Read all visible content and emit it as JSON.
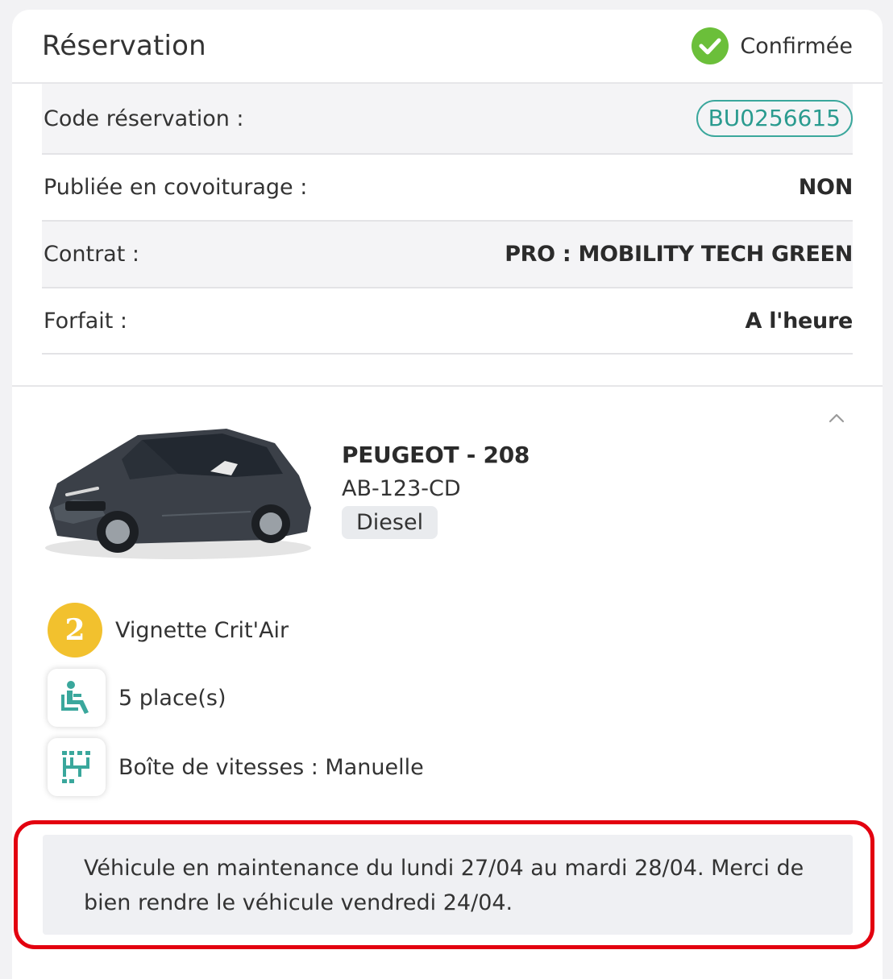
{
  "header": {
    "title": "Réservation",
    "status": {
      "label": "Confirmée",
      "icon": "check-circle-icon",
      "color": "#6bbf3a"
    }
  },
  "details": [
    {
      "label": "Code réservation :",
      "value": "BU0256615"
    },
    {
      "label": "Publiée en covoiturage :",
      "value": "NON"
    },
    {
      "label": "Contrat :",
      "value": "PRO : MOBILITY TECH GREEN"
    },
    {
      "label": "Forfait :",
      "value": "A l'heure"
    }
  ],
  "vehicle": {
    "name": "PEUGEOT - 208",
    "plate": "AB-123-CD",
    "fuel": "Diesel",
    "collapse_icon": "chevron-up-icon"
  },
  "features": [
    {
      "icon": "critair-2-icon",
      "badge": "2",
      "text": "Vignette Crit'Air"
    },
    {
      "icon": "seat-icon",
      "text": "5 place(s)"
    },
    {
      "icon": "gearbox-icon",
      "text": "Boîte de vitesses : Manuelle"
    }
  ],
  "notice": {
    "text": "Véhicule en maintenance du lundi 27/04 au mardi 28/04. Merci de bien rendre le véhicule vendredi 24/04.",
    "highlight_color": "#e3000f"
  },
  "colors": {
    "accent_teal": "#2a9b8f",
    "critair_yellow": "#f2c12e",
    "icon_teal": "#3aa79c"
  }
}
